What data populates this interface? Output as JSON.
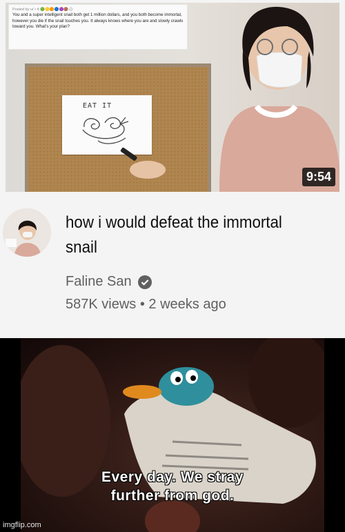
{
  "thumbnail": {
    "post_meta": "Posted by u/ • 4 🟢🟡🟠🔵🟣🟤⚪",
    "post_text": "You and a super intelligent snail both get 1 million dollars, and you both become immortal, however you die if the snail touches you. It always knows where you are and slowly crawls toward you. What's your plan?",
    "paper_caption": "EAT IT",
    "duration": "9:54"
  },
  "video": {
    "title": "how i would defeat the immortal snail",
    "channel": "Faline San",
    "views": "587K views",
    "separator": "•",
    "age": "2 weeks ago"
  },
  "meme": {
    "line1": "Every day. We stray",
    "line2": "further from god."
  },
  "watermark": "imgflip.com"
}
